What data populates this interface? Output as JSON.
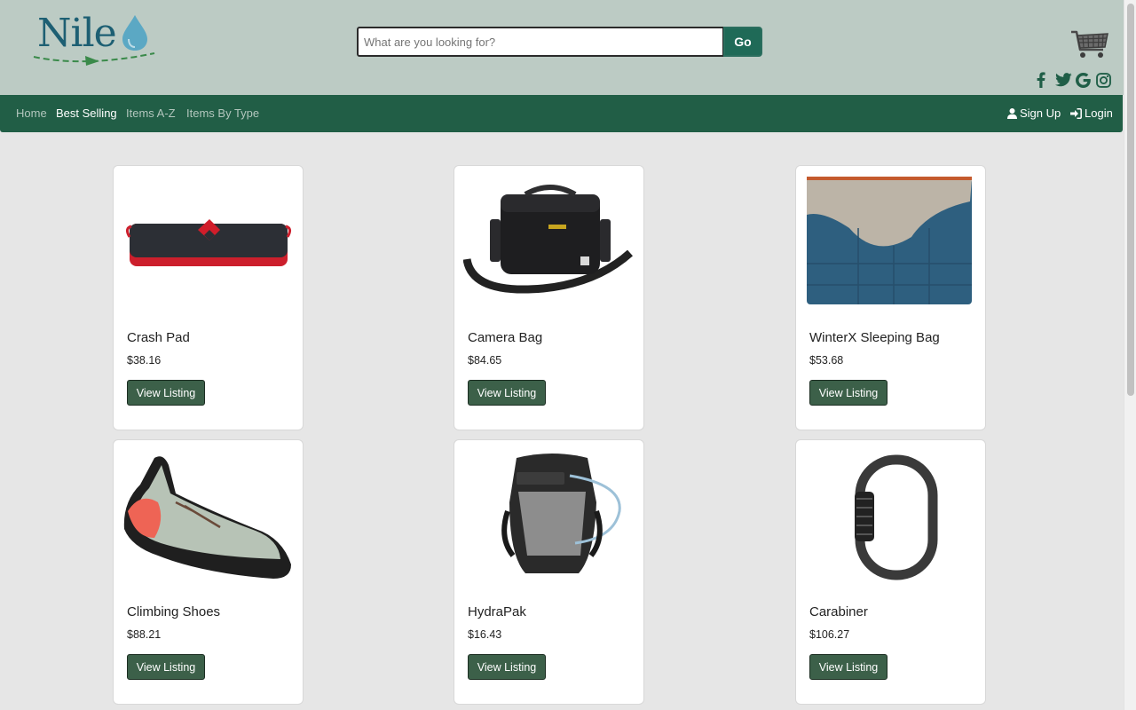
{
  "brand": {
    "name": "Nile"
  },
  "search": {
    "placeholder": "What are you looking for?",
    "value": "",
    "button_label": "Go"
  },
  "header_icons": [
    "cart-icon",
    "facebook-icon",
    "twitter-icon",
    "google-icon",
    "instagram-icon"
  ],
  "nav": {
    "links": [
      {
        "label": "Home",
        "active": false
      },
      {
        "label": "Best Selling",
        "active": true
      },
      {
        "label": "Items A-Z",
        "active": false
      },
      {
        "label": "Items By Type",
        "active": false
      }
    ],
    "signup_label": "Sign Up",
    "login_label": "Login"
  },
  "products": [
    {
      "name": "Crash Pad",
      "price": "$38.16",
      "button": "View Listing",
      "image": "crash-pad-image"
    },
    {
      "name": "Camera Bag",
      "price": "$84.65",
      "button": "View Listing",
      "image": "camera-bag-image"
    },
    {
      "name": "WinterX Sleeping Bag",
      "price": "$53.68",
      "button": "View Listing",
      "image": "sleeping-bag-image"
    },
    {
      "name": "Climbing Shoes",
      "price": "$88.21",
      "button": "View Listing",
      "image": "climbing-shoe-image"
    },
    {
      "name": "HydraPak",
      "price": "$16.43",
      "button": "View Listing",
      "image": "hydration-pack-image"
    },
    {
      "name": "Carabiner",
      "price": "$106.27",
      "button": "View Listing",
      "image": "carabiner-image"
    }
  ],
  "colors": {
    "header_bg": "#bccbc4",
    "nav_bg": "#215e46",
    "button_bg": "#3c6049",
    "go_button": "#1f6a57",
    "page_bg": "#e6e6e6"
  }
}
